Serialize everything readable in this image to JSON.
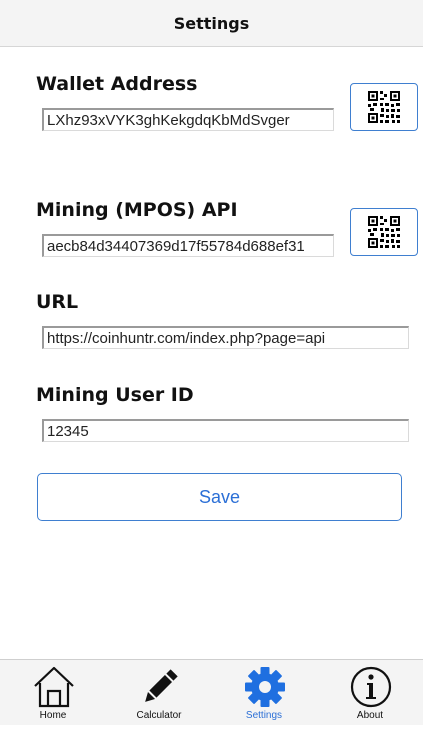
{
  "header": {
    "title": "Settings"
  },
  "form": {
    "wallet": {
      "label": "Wallet Address",
      "value": "LXhz93xVYK3ghKekgdqKbMdSvger",
      "scan_icon": "qr-code-icon"
    },
    "mpos": {
      "label": "Mining (MPOS) API",
      "value": "aecb84d34407369d17f55784d688ef31",
      "scan_icon": "qr-code-icon"
    },
    "url": {
      "label": "URL",
      "value": "https://coinhuntr.com/index.php?page=api"
    },
    "user_id": {
      "label": "Mining User ID",
      "value": "12345"
    },
    "save_label": "Save"
  },
  "tabs": [
    {
      "label": "Home",
      "icon": "home-icon",
      "active": false
    },
    {
      "label": "Calculator",
      "icon": "pencil-icon",
      "active": false
    },
    {
      "label": "Settings",
      "icon": "gear-icon",
      "active": true
    },
    {
      "label": "About",
      "icon": "info-icon",
      "active": false
    }
  ],
  "colors": {
    "accent": "#2b6fd6",
    "button_border": "#3f7fd0",
    "bar_background": "#f4f4f4"
  }
}
